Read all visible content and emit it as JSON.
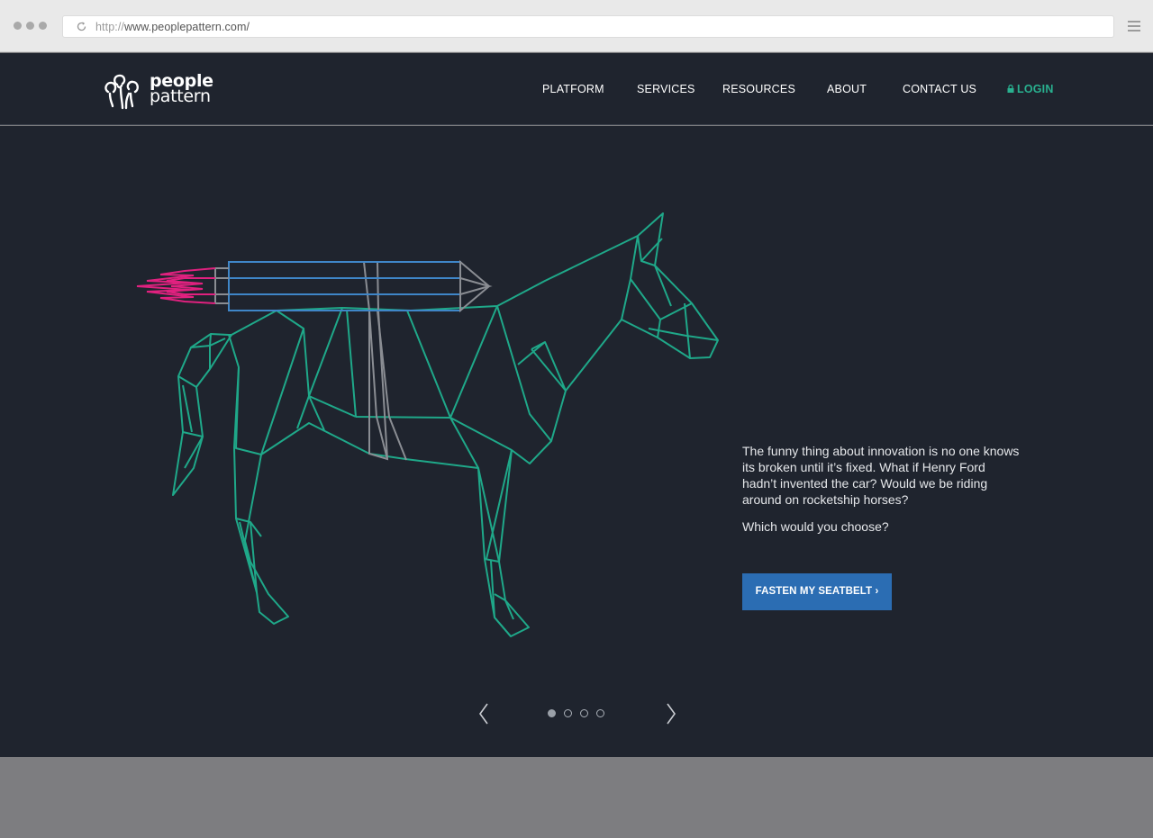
{
  "browser": {
    "url_protocol": "http://",
    "url_host": "www.peoplepattern.com/"
  },
  "header": {
    "logo_line1": "people",
    "logo_line2": "pattern",
    "nav": [
      {
        "label": "PLATFORM"
      },
      {
        "label": "SERVICES"
      },
      {
        "label": "RESOURCES"
      },
      {
        "label": "ABOUT"
      },
      {
        "label": "CONTACT US"
      },
      {
        "label": "LOGIN"
      }
    ]
  },
  "hero": {
    "paragraph1": "The funny thing about innovation is no one knows its broken until it’s fixed. What if Henry Ford hadn’t invented the car?  Would we be riding around on rocketship horses?",
    "paragraph2": "Which would you choose?",
    "cta_label": "FASTEN MY SEATBELT ›",
    "slides_total": 4,
    "active_slide": 1
  },
  "colors": {
    "header_bg": "#1f242e",
    "horse_line": "#1fa889",
    "rocket_blue": "#3f86c8",
    "flame_pink": "#e0217f",
    "cta_bg": "#2b6db3",
    "login_green": "#29b08f"
  }
}
